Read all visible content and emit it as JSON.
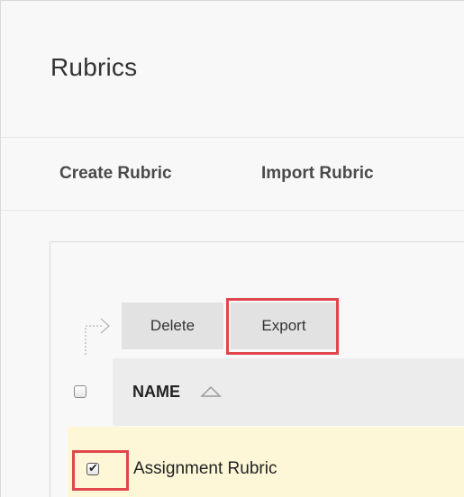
{
  "page": {
    "title": "Rubrics"
  },
  "actions": {
    "create_label": "Create Rubric",
    "import_label": "Import Rubric"
  },
  "toolbar": {
    "delete_label": "Delete",
    "export_label": "Export"
  },
  "table": {
    "columns": [
      {
        "label": "NAME",
        "sort": "ascending"
      }
    ],
    "rows": [
      {
        "name": "Assignment Rubric",
        "checked": true
      }
    ]
  },
  "colors": {
    "highlight": "#e0464b",
    "selected_row": "#fdf7d8",
    "button_bg": "#e2e2e2"
  },
  "icons": {
    "toolbar_arrow": "select-arrow-icon",
    "sort": "sort-ascending-icon"
  }
}
